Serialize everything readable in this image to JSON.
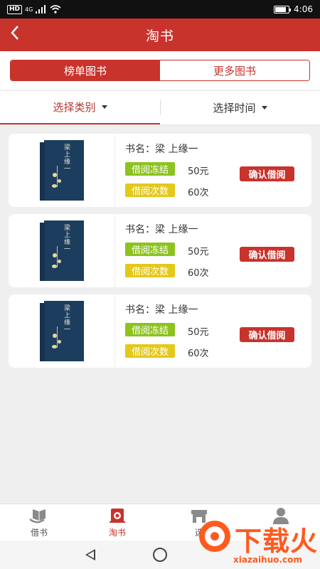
{
  "status_bar": {
    "network": "HD",
    "signal": "4G",
    "time": "4:06",
    "battery_level": 0.85
  },
  "header": {
    "title": "淘书",
    "back_icon": "chevron-left-icon"
  },
  "segments": [
    {
      "label": "榜单图书",
      "active": true
    },
    {
      "label": "更多图书",
      "active": false
    }
  ],
  "filters": [
    {
      "label": "选择类别",
      "active": true
    },
    {
      "label": "选择时间",
      "active": false
    }
  ],
  "books": [
    {
      "name_label": "书名：",
      "name": "梁 上缘一",
      "freeze_label": "借阅冻结",
      "freeze_value": "50元",
      "count_label": "借阅次数",
      "count_value": "60次",
      "action": "确认借阅",
      "cover_title": "梁上缘一"
    },
    {
      "name_label": "书名：",
      "name": "梁 上缘一",
      "freeze_label": "借阅冻结",
      "freeze_value": "50元",
      "count_label": "借阅次数",
      "count_value": "60次",
      "action": "确认借阅",
      "cover_title": "梁上缘一"
    },
    {
      "name_label": "书名：",
      "name": "梁 上缘一",
      "freeze_label": "借阅冻结",
      "freeze_value": "50元",
      "count_label": "借阅次数",
      "count_value": "60次",
      "action": "确认借阅",
      "cover_title": "梁上缘一"
    }
  ],
  "tabbar": [
    {
      "label": "借书",
      "icon": "open-book-hand-icon",
      "active": false
    },
    {
      "label": "淘书",
      "icon": "bookshelf-icon",
      "active": true
    },
    {
      "label": "选",
      "icon": "store-icon",
      "active": false
    },
    {
      "label": "",
      "icon": "person-icon",
      "active": false
    }
  ],
  "watermark": {
    "text": "下载火",
    "url": "xiazaihuo.com"
  },
  "colors": {
    "primary": "#c8332c",
    "green_tag": "#8dc21f",
    "yellow_tag": "#e4c81a",
    "watermark": "#ff5a1f"
  }
}
